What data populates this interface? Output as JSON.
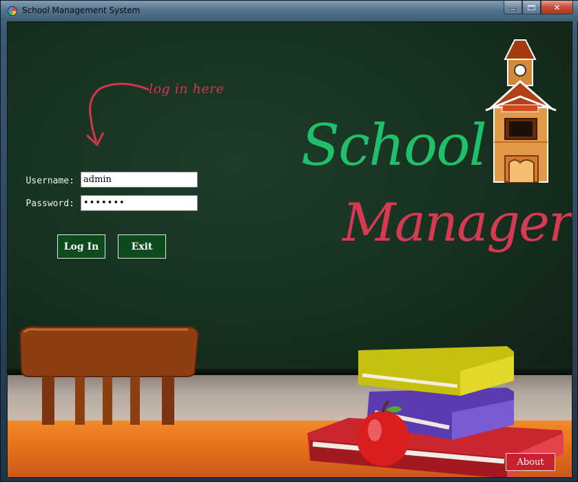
{
  "window": {
    "title": "School Management System",
    "icon": "app-icon",
    "controls": {
      "minimize": "minimize-icon",
      "maximize": "maximize-icon",
      "close": "✕"
    }
  },
  "login": {
    "hint_text": "log in here",
    "username_label": "Username:",
    "username_value": "admin",
    "password_label": "Password:",
    "password_value": "•••••••",
    "login_button": "Log In",
    "exit_button": "Exit"
  },
  "logo": {
    "line1": "School",
    "line2": "Manager",
    "colors": {
      "school": "#1fbf6b",
      "manager": "#d43a52"
    }
  },
  "footer": {
    "about_button": "About"
  },
  "colors": {
    "chalkboard": "#17301f",
    "button_bg": "#0d4a1c",
    "about_bg": "#c8202c",
    "hint": "#d4354f"
  }
}
